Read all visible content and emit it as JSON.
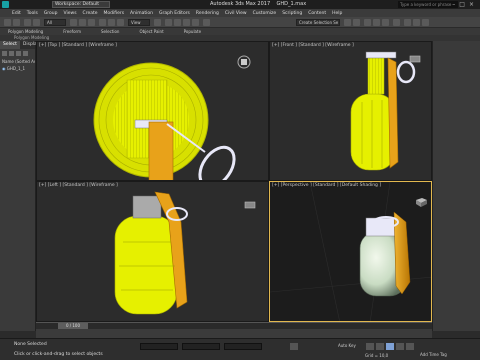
{
  "titlebar": {
    "workspace": "Workspace: Default",
    "title": "Autodesk 3ds Max 2017",
    "filename": "GHD_1.max",
    "search_placeholder": "Type a keyword or phrase"
  },
  "menu": [
    "Edit",
    "Tools",
    "Group",
    "Views",
    "Create",
    "Modifiers",
    "Animation",
    "Graph Editors",
    "Rendering",
    "Civil View",
    "Customize",
    "Scripting",
    "Content",
    "Help"
  ],
  "toolbar": {
    "filter": "All",
    "view": "View",
    "selection_set": "Create Selection Se"
  },
  "ribbon": {
    "tabs": [
      "Polygon Modeling",
      "Freeform",
      "Selection",
      "Object Paint",
      "Populate"
    ],
    "sub": "Polygon Modeling"
  },
  "scene_explorer": {
    "tabs": [
      "Select",
      "Display"
    ],
    "root": "Name (Sorted Ascending)",
    "item": "GHD_1_1"
  },
  "viewports": {
    "top": "[+] [Top ] [Standard ] [Wireframe ]",
    "front": "[+] [Front ] [Standard ] [Wireframe ]",
    "left": "[+] [Left ] [Standard ] [Wireframe ]",
    "perspective": "[+] [Perspective ] [Standard ] [Default Shading ]"
  },
  "timeline": {
    "frame": "0 / 100"
  },
  "status": {
    "selection": "None Selected",
    "hint": "Click or click-and-drag to select objects",
    "autokey": "Auto Key",
    "grid": "Grid = 10,0",
    "add_time_tag": "Add Time Tag"
  },
  "colors": {
    "wire_yellow": "#e6f000",
    "handle_orange": "#e8a21a",
    "ring_white": "#e8e8f8",
    "active_border": "#e2b84f"
  }
}
